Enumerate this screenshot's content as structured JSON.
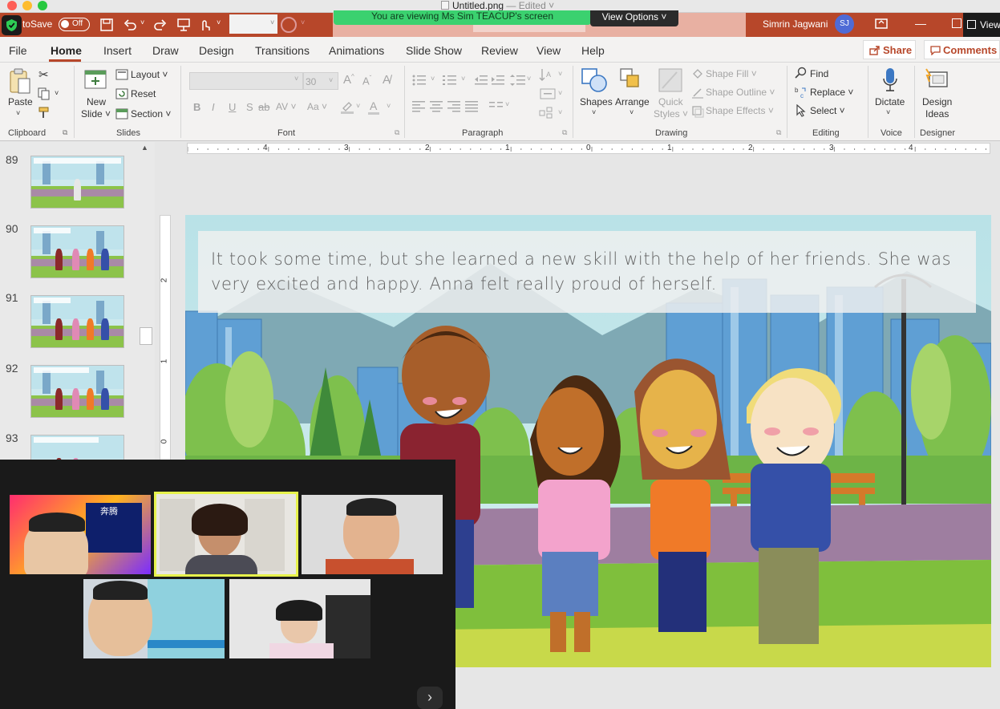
{
  "mac": {
    "title": "Untitled.png",
    "edited": "— Edited ˅"
  },
  "titlebar": {
    "autosave_label": "toSave",
    "autosave_state": "Off",
    "share_banner": "You are viewing Ms Sim TEACUP's screen",
    "view_options": "View Options ˅",
    "user_name": "Simrin Jagwani",
    "user_initials": "SJ",
    "view_btn": "View"
  },
  "tabs": [
    "File",
    "Home",
    "Insert",
    "Draw",
    "Design",
    "Transitions",
    "Animations",
    "Slide Show",
    "Review",
    "View",
    "Help"
  ],
  "active_tab": "Home",
  "share_label": "Share",
  "comments_label": "Comments",
  "ribbon": {
    "clipboard": {
      "paste": "Paste",
      "label": "Clipboard"
    },
    "slides": {
      "new1": "New",
      "new2": "Slide ˅",
      "layout": "Layout ˅",
      "reset": "Reset",
      "section": "Section ˅",
      "label": "Slides"
    },
    "font": {
      "size": "30",
      "label": "Font",
      "b": "B",
      "i": "I",
      "u": "U",
      "s": "S",
      "av": "AV ˅",
      "aa": "Aa ˅"
    },
    "paragraph": {
      "label": "Paragraph"
    },
    "drawing": {
      "shapes": "Shapes",
      "arrange": "Arrange",
      "quick1": "Quick",
      "quick2": "Styles ˅",
      "fill": "Shape Fill ˅",
      "outline": "Shape Outline ˅",
      "effects": "Shape Effects ˅",
      "label": "Drawing"
    },
    "editing": {
      "find": "Find",
      "replace": "Replace ˅",
      "select": "Select ˅",
      "label": "Editing"
    },
    "voice": {
      "dictate": "Dictate",
      "label": "Voice"
    },
    "designer": {
      "ideas1": "Design",
      "ideas2": "Ideas",
      "label": "Designer"
    }
  },
  "slides": [
    {
      "num": "89",
      "kids": 1
    },
    {
      "num": "90",
      "kids": 4
    },
    {
      "num": "91",
      "kids": 4
    },
    {
      "num": "92",
      "kids": 4
    },
    {
      "num": "93",
      "kids": 4
    }
  ],
  "ruler": {
    "h": [
      "4",
      "3",
      "2",
      "1",
      "0",
      "1",
      "2",
      "3",
      "4"
    ],
    "v": [
      "2",
      "1",
      "0"
    ]
  },
  "slide": {
    "caption": "It took some time, but she learned a new skill with the help of her friends. She was very excited and happy. Anna felt really proud of herself."
  },
  "zoom": {
    "tile1_title": "奔腾",
    "next": "›"
  }
}
